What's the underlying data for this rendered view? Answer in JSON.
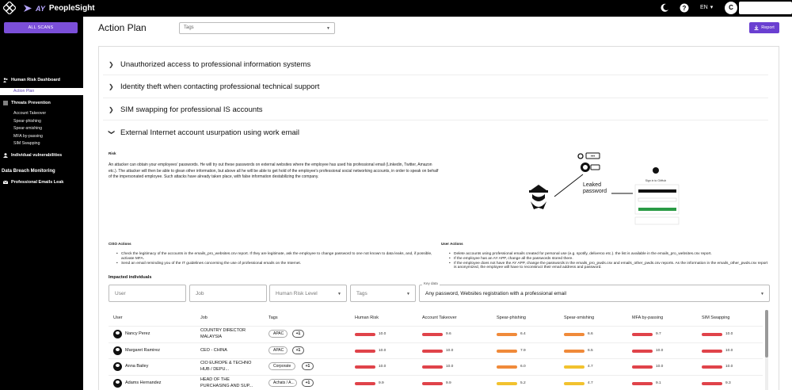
{
  "topbar": {
    "brand_ay": "AY",
    "brand_name": "PeopleSight",
    "lang": "EN",
    "avatar_letter": "C"
  },
  "sidebar": {
    "all_scans": "ALL SCANS",
    "human_risk": "Human Risk Dashboard",
    "action_plan": "Action Plan",
    "threats": "Threats Prevention",
    "threat_items": [
      "Account Takeover",
      "Spear-phishing",
      "Spear-smishing",
      "MFA by-passing",
      "SIM Swapping"
    ],
    "individual": "Individual vulnerabilities",
    "data_breach": "Data Breach Monitoring",
    "emails_leak": "Professional Emails Leak"
  },
  "header": {
    "title": "Action Plan",
    "tags_placeholder": "Tags",
    "report": "Report"
  },
  "accordion": [
    "Unauthorized access to professional information systems",
    "Identity theft when contacting professional technical support",
    "SIM swapping for professional IS accounts",
    "External Internet account usurpation using work email"
  ],
  "risk": {
    "label": "Risk",
    "text": "An attacker can obtain your employees' passwords. He will try out these passwords on external websites where the employee has used his professional email (Linkedin, Twitter, Amazon etc.). The attacker will then be able to glean other information, but above all he will be able to get hold of the employee's professional social networking accounts, in order to speak on behalf of the impersonated employee. Such attacks have already taken place, with false information destabilizing the company.",
    "illustration_label_1": "Leaked",
    "illustration_label_2": "password",
    "signin_title": "Sign in to GitHub"
  },
  "ciso": {
    "label": "CISO Actions",
    "items": [
      "Check the legitimacy of the accounts in the emails_pro_websites.csv report. If they are legitimate, ask the employee to change password to one not known to data leaks, and, if possible, activate MFA.",
      "Send an email reminding you of the IT guidelines concerning the use of professional emails on the Internet."
    ]
  },
  "user_actions": {
    "label": "User Actions",
    "items": [
      "Delete accounts using professional emails created for personal use (e.g. spotify, deliveroo etc.). the list is available in the emails_pro_websites.csv report.",
      "If the employee has an AY APP, change all the passwords stored there.",
      "If the employee does not have the AY APP, change the passwords in the emails_pro_pwds.csv and emails_other_pwds.csv reports. As the information in the emails_other_pwds.csv report is anonymized, the employee will have to reconstruct their email address and password."
    ]
  },
  "filters": {
    "impacted": "Impacted individuals",
    "user": "User",
    "job": "Job",
    "risk_level": "Human Risk Level",
    "tags": "Tags",
    "key_data_legend": "Key data",
    "key_data_value": "Any password, Websites registration with a professional email"
  },
  "table": {
    "columns": [
      "User",
      "Job",
      "Tags",
      "Human Risk",
      "Account Takeover",
      "Spear-phishing",
      "Spear-smishing",
      "MFA by-passing",
      "SIM Swapping"
    ],
    "rows": [
      {
        "user": "Nancy Perez",
        "job1": "COUNTRY DIRECTOR",
        "job2": "MALAYSIA",
        "tag": "APAC",
        "plus": "+1",
        "scores": [
          "10.0",
          "9.6",
          "6.4",
          "6.6",
          "9.7",
          "10.0"
        ]
      },
      {
        "user": "Margaret Ramirez",
        "job1": "CEO - CHINA",
        "job2": "",
        "tag": "APAC",
        "plus": "+1",
        "scores": [
          "10.0",
          "10.0",
          "7.9",
          "6.5",
          "10.0",
          "10.0"
        ]
      },
      {
        "user": "Anna Bailey",
        "job1": "CIO EUROPE & TECHNO",
        "job2": "HUB / DEPU...",
        "tag": "Corporate",
        "plus": "+1",
        "scores": [
          "10.0",
          "10.0",
          "6.0",
          "4.7",
          "10.0",
          "10.0"
        ]
      },
      {
        "user": "Adams Hernandez",
        "job1": "HEAD OF THE",
        "job2": "PURCHASING AND SUP...",
        "tag": "Achats / A...",
        "plus": "+1",
        "scores": [
          "9.9",
          "9.9",
          "5.2",
          "4.7",
          "9.1",
          "9.3"
        ]
      }
    ]
  },
  "colors": {
    "accent": "#6a3fd1",
    "red": "#e0434a",
    "orange": "#f08a3a",
    "yellow": "#f2c22e"
  }
}
